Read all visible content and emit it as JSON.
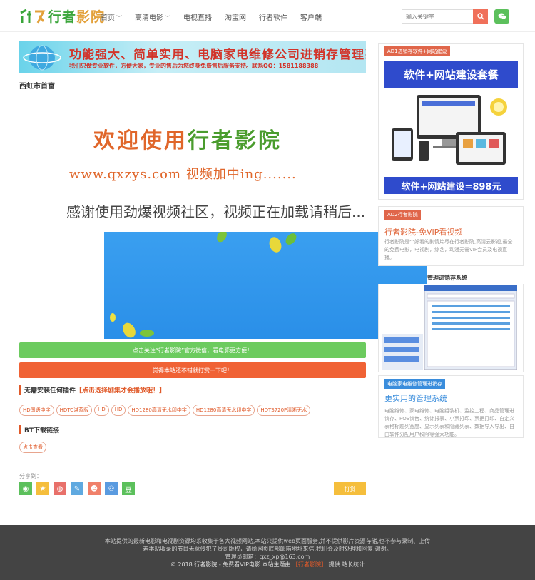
{
  "header": {
    "logo": {
      "part1": "行者",
      "part2": "影院"
    },
    "nav": [
      {
        "label": "首页",
        "dropdown": true
      },
      {
        "label": "高清电影",
        "dropdown": true
      },
      {
        "label": "电视直播",
        "dropdown": false
      },
      {
        "label": "淘宝网",
        "dropdown": false
      },
      {
        "label": "行者软件",
        "dropdown": false
      },
      {
        "label": "客户端",
        "dropdown": false
      }
    ],
    "search_placeholder": "输入关键字"
  },
  "banner": {
    "title": "功能强大、简单实用、电脑家电维修公司进销存管理系统",
    "subtitle": "我们只做专业软件，方便大家，专业的售后为您终身免费售后服务支持。联系QQ：1581188388"
  },
  "page_title": "西虹市首富",
  "player": {
    "welcome": {
      "part1": "欢迎使用",
      "part2": "行者影院"
    },
    "url": {
      "part1": "www.qxzys.com",
      "part2": "视频加中ing......."
    },
    "loading": "感谢使用劲爆视频社区，视频正在加载请稍后..."
  },
  "bars": {
    "follow": "点击关注“行者影院”官方微信，看电影更方便！",
    "warning": "觉得本站还不错就打赏一下吧！"
  },
  "plugin_section": {
    "title": "无需安装任何插件",
    "highlight": "【点击选择剧集才会播放哦！】"
  },
  "tags": [
    "HD国语中字",
    "HDTC湛蓝版",
    "HD",
    "HD",
    "HD1280高清无水印中字",
    "HD1280高清无水印中字",
    "HDTS720P清晰无水"
  ],
  "bt_section": {
    "title": "BT下载链接",
    "button": "点击查看"
  },
  "share": {
    "label": "分享到：",
    "icons": [
      {
        "name": "wechat",
        "color": "#5cc05c",
        "glyph": "◉"
      },
      {
        "name": "qzone",
        "color": "#f5be3c",
        "glyph": "★"
      },
      {
        "name": "weibo",
        "color": "#e8706a",
        "glyph": "◍"
      },
      {
        "name": "tencent-weibo",
        "color": "#5fa9e0",
        "glyph": "✎"
      },
      {
        "name": "qq",
        "color": "#f0806a",
        "glyph": "☻"
      },
      {
        "name": "renren",
        "color": "#5a9be0",
        "glyph": "⚇"
      },
      {
        "name": "douban",
        "color": "#5cc05c",
        "glyph": "豆"
      }
    ],
    "reward": "打赏"
  },
  "sidebar": {
    "ad1": {
      "badge": "AD1进销存软件+网站建设",
      "top": "软件+网站建设套餐",
      "bottom": "软件+网站建设=898元"
    },
    "ad2": {
      "badge": "AD2行者影院",
      "title": "行者影院-免VIP看视频",
      "desc": "行者影院是个好看的剧情片尽在行者影院,高清云影视,最全的免费电影，电视剧，综艺，动漫无需VIP会员及电视直播。"
    },
    "ad3": {
      "title": "管理进销存系统"
    },
    "ad4": {
      "badge": "电脑家电维修管理进销存",
      "title": "更实用的管理系统",
      "desc": "电脑维修、家电维修、电脑组装机、监控工程、商品管理进销存、POS销售、统计报表、小票打印、票据打印、自定义表格标题列宽度、显示列表和隐藏列表、数据导入导出、自由软件分配用户权限等强大功能。"
    }
  },
  "footer": {
    "line1": "本站提供的最新电影和电视剧资源均系收集于各大视频网站,本站只提供web页面服务,并不提供影片资源存储,也不参与录制、上传",
    "line2": "若本站收录的节目无意侵犯了贵司版权，请给网页底部邮箱地址来信,我们会及时处理和回复,谢谢。",
    "line3": "管理员邮箱：qxz_xp@163.com",
    "line4_a": "© 2018 行者影院 - 免费看VIP电影 本站主题由",
    "line4_b": "【行者影院】",
    "line4_c": "提供 站长统计"
  }
}
